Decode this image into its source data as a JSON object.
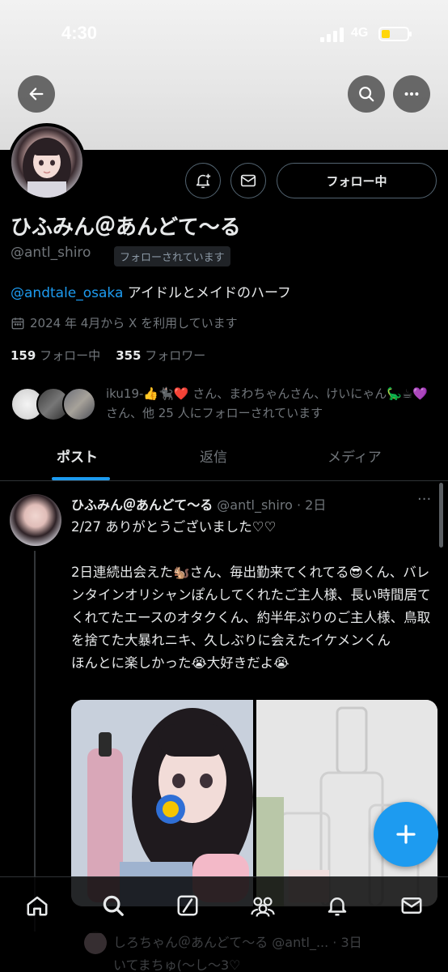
{
  "status_bar": {
    "time": "4:30",
    "network": "4G"
  },
  "profile": {
    "display_name": "ひふみん＠あんどて〜る",
    "handle": "@antl_shiro",
    "follows_you": "フォローされています",
    "follow_button": "フォロー中",
    "bio_mention": "@andtale_osaka",
    "bio_text": " アイドルとメイドのハーフ",
    "joined": "2024 年 4月から X を利用しています",
    "following_count": "159",
    "following_label": "フォロー中",
    "followers_count": "355",
    "followers_label": "フォロワー",
    "mutuals_text": "iku19-👍🐈‍⬛❤️ さん、まわちゃんさん、けいにゃん🦕☕💜 さん、他 25 人にフォローされています"
  },
  "tabs": [
    {
      "label": "ポスト",
      "active": true
    },
    {
      "label": "返信",
      "active": false
    },
    {
      "label": "メディア",
      "active": false
    }
  ],
  "post": {
    "author": "ひふみん＠あんどて〜る",
    "meta": " @antl_shiro · 2日",
    "more": "···",
    "text": "2/27 ありがとうございました♡♡\n\n2日連続出会えた🐿️さん、毎出勤来てくれてる😎くん、バレンタインオリシャンぽんしてくれたご主人様、長い時間居てくれてたエースのオタクくん、約半年ぶりのご主人様、鳥取を捨てた大暴れニキ、久しぶりに会えたイケメンくん\nほんとに楽しかった😭大好きだよ😭"
  },
  "next_post_peek": "しろちゃん＠あんどて〜る @antl_... · 3日\nいてまちゅ(〜し〜3♡",
  "icons": {
    "back": "back-arrow-icon",
    "search": "search-icon",
    "more": "more-icon",
    "notify": "notification-add-icon",
    "message": "mail-icon",
    "compose": "plus-icon",
    "nav": [
      "home-icon",
      "search-icon",
      "grok-icon",
      "communities-icon",
      "bell-icon",
      "mail-icon"
    ]
  },
  "colors": {
    "accent": "#1d9bf0",
    "background": "#000000",
    "muted": "#71767b"
  }
}
